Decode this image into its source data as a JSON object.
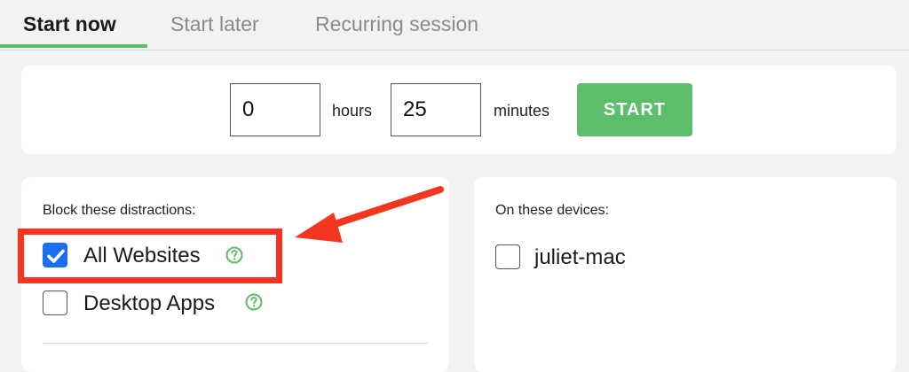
{
  "tabs": [
    {
      "label": "Start now",
      "active": true
    },
    {
      "label": "Start later",
      "active": false
    },
    {
      "label": "Recurring session",
      "active": false
    }
  ],
  "timer": {
    "hours_value": "0",
    "hours_label": "hours",
    "minutes_value": "25",
    "minutes_label": "minutes",
    "start_label": "START"
  },
  "block": {
    "heading": "Block these distractions:",
    "options": [
      {
        "label": "All Websites",
        "checked": true
      },
      {
        "label": "Desktop Apps",
        "checked": false
      }
    ]
  },
  "devices": {
    "heading": "On these devices:",
    "items": [
      {
        "label": "juliet-mac",
        "checked": false
      }
    ]
  },
  "colors": {
    "accent_green": "#5cbd6a",
    "checkbox_blue": "#1a6ff0",
    "annotation_red": "#f2361f",
    "help_icon_green": "#5cbd6a"
  },
  "icons": {
    "check": "checkmark-icon",
    "help": "question-circle-icon",
    "annotation": "red-arrow-icon"
  }
}
